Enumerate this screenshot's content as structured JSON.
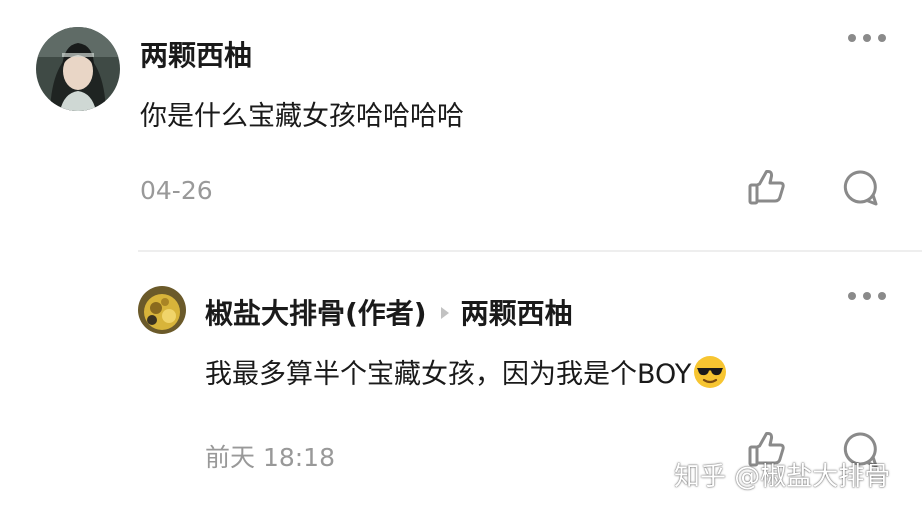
{
  "comments": [
    {
      "author": "两颗西柚",
      "content": "你是什么宝藏女孩哈哈哈哈",
      "time": "04-26"
    },
    {
      "author": "椒盐大排骨(作者)",
      "reply_to": "两颗西柚",
      "content": "我最多算半个宝藏女孩，因为我是个BOY",
      "emoji": "sunglasses-emoji",
      "time": "前天 18:18"
    }
  ],
  "watermark": "知乎 @椒盐大排骨",
  "icons": {
    "more": "more-dots-icon",
    "like": "thumbs-up-icon",
    "reply": "comment-bubble-icon"
  },
  "colors": {
    "text": "#1a1a1a",
    "meta": "#999999",
    "icon": "#8a8a8a",
    "divider": "#eeeeee"
  }
}
